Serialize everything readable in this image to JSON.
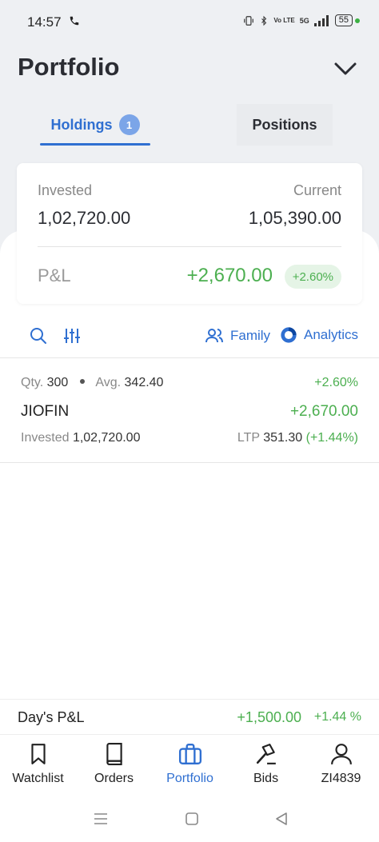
{
  "status_bar": {
    "time": "14:57",
    "signal_label": "5G",
    "lte_label": "Vo LTE",
    "battery": "55"
  },
  "header": {
    "title": "Portfolio"
  },
  "tabs": {
    "holdings_label": "Holdings",
    "holdings_count": "1",
    "positions_label": "Positions"
  },
  "summary": {
    "invested_label": "Invested",
    "invested_value": "1,02,720.00",
    "current_label": "Current",
    "current_value": "1,05,390.00",
    "pl_label": "P&L",
    "pl_value": "+2,670.00",
    "pl_percent": "+2.60%"
  },
  "toolbar": {
    "family_label": "Family",
    "analytics_label": "Analytics"
  },
  "holdings": [
    {
      "qty_label": "Qty.",
      "qty": "300",
      "avg_label": "Avg.",
      "avg": "342.40",
      "percent": "+2.60%",
      "name": "JIOFIN",
      "pl": "+2,670.00",
      "invested_label": "Invested",
      "invested": "1,02,720.00",
      "ltp_label": "LTP",
      "ltp": "351.30",
      "ltp_change": "(+1.44%)"
    }
  ],
  "days_pl": {
    "label": "Day's P&L",
    "value": "+1,500.00",
    "percent": "+1.44 %"
  },
  "bottom_nav": {
    "watchlist": "Watchlist",
    "orders": "Orders",
    "portfolio": "Portfolio",
    "bids": "Bids",
    "profile": "ZI4839"
  },
  "colors": {
    "accent": "#2f6fd1",
    "gain": "#4caf50",
    "header_bg": "#eef0f3"
  },
  "icons": [
    "phone-icon",
    "chevron-down-icon",
    "search-icon",
    "filter-icon",
    "family-icon",
    "analytics-icon",
    "bookmark-icon",
    "book-icon",
    "briefcase-icon",
    "gavel-icon",
    "user-icon"
  ]
}
